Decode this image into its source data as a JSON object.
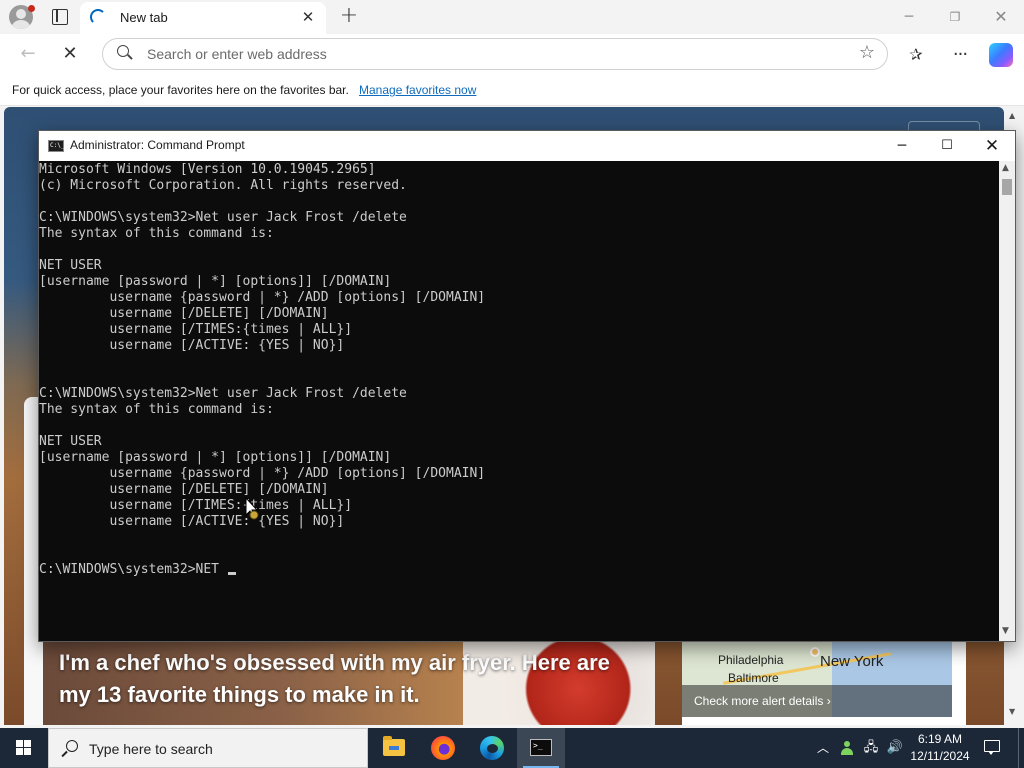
{
  "browser": {
    "tab_title": "New tab",
    "tab_close_glyph": "✕",
    "new_tab_glyph": "+",
    "window_min_glyph": "─",
    "window_max_glyph": "❐",
    "window_close_glyph": "✕",
    "back_glyph": "←",
    "stop_glyph": "✕",
    "address_placeholder": "Search or enter web address",
    "address_value": "",
    "favorite_star_glyph": "☆",
    "favorites_glyph": "✰",
    "more_glyph": "···",
    "favorites_bar_message": "For quick access, place your favorites here on the favorites bar.",
    "favorites_bar_link": "Manage favorites now"
  },
  "new_tab_page": {
    "news_headline": "I'm a chef who's obsessed with my air fryer. Here are my 13 favorite things to make in it.",
    "map_cities": [
      "Philadelphia",
      "New York",
      "Baltimore"
    ],
    "map_alert_link": "Check more alert details ›"
  },
  "cmd": {
    "title": "Administrator: Command Prompt",
    "min_glyph": "─",
    "max_glyph": "☐",
    "close_glyph": "✕",
    "output_lines": [
      "Microsoft Windows [Version 10.0.19045.2965]",
      "(c) Microsoft Corporation. All rights reserved.",
      "",
      "C:\\WINDOWS\\system32>Net user Jack Frost /delete",
      "The syntax of this command is:",
      "",
      "NET USER",
      "[username [password | *] [options]] [/DOMAIN]",
      "         username {password | *} /ADD [options] [/DOMAIN]",
      "         username [/DELETE] [/DOMAIN]",
      "         username [/TIMES:{times | ALL}]",
      "         username [/ACTIVE: {YES | NO}]",
      "",
      "",
      "C:\\WINDOWS\\system32>Net user Jack Frost /delete",
      "The syntax of this command is:",
      "",
      "NET USER",
      "[username [password | *] [options]] [/DOMAIN]",
      "         username {password | *} /ADD [options] [/DOMAIN]",
      "         username [/DELETE] [/DOMAIN]",
      "         username [/TIMES:{times | ALL}]",
      "         username [/ACTIVE: {YES | NO}]",
      "",
      ""
    ],
    "prompt_line": "C:\\WINDOWS\\system32>NET "
  },
  "taskbar": {
    "search_placeholder": "Type here to search",
    "apps": [
      {
        "name": "file-explorer",
        "active": false
      },
      {
        "name": "firefox",
        "active": false
      },
      {
        "name": "edge",
        "active": false
      },
      {
        "name": "command-prompt",
        "active": true
      }
    ],
    "tray_chevron_glyph": "︿",
    "tray_network_glyph": "🖧",
    "tray_volume_glyph": "🔊",
    "time": "6:19 AM",
    "date": "12/11/2024"
  },
  "colors": {
    "console_bg": "#0c0c0c",
    "console_text": "#cccccc",
    "taskbar_bg": "#1c2838",
    "link": "#0f6cbd"
  }
}
